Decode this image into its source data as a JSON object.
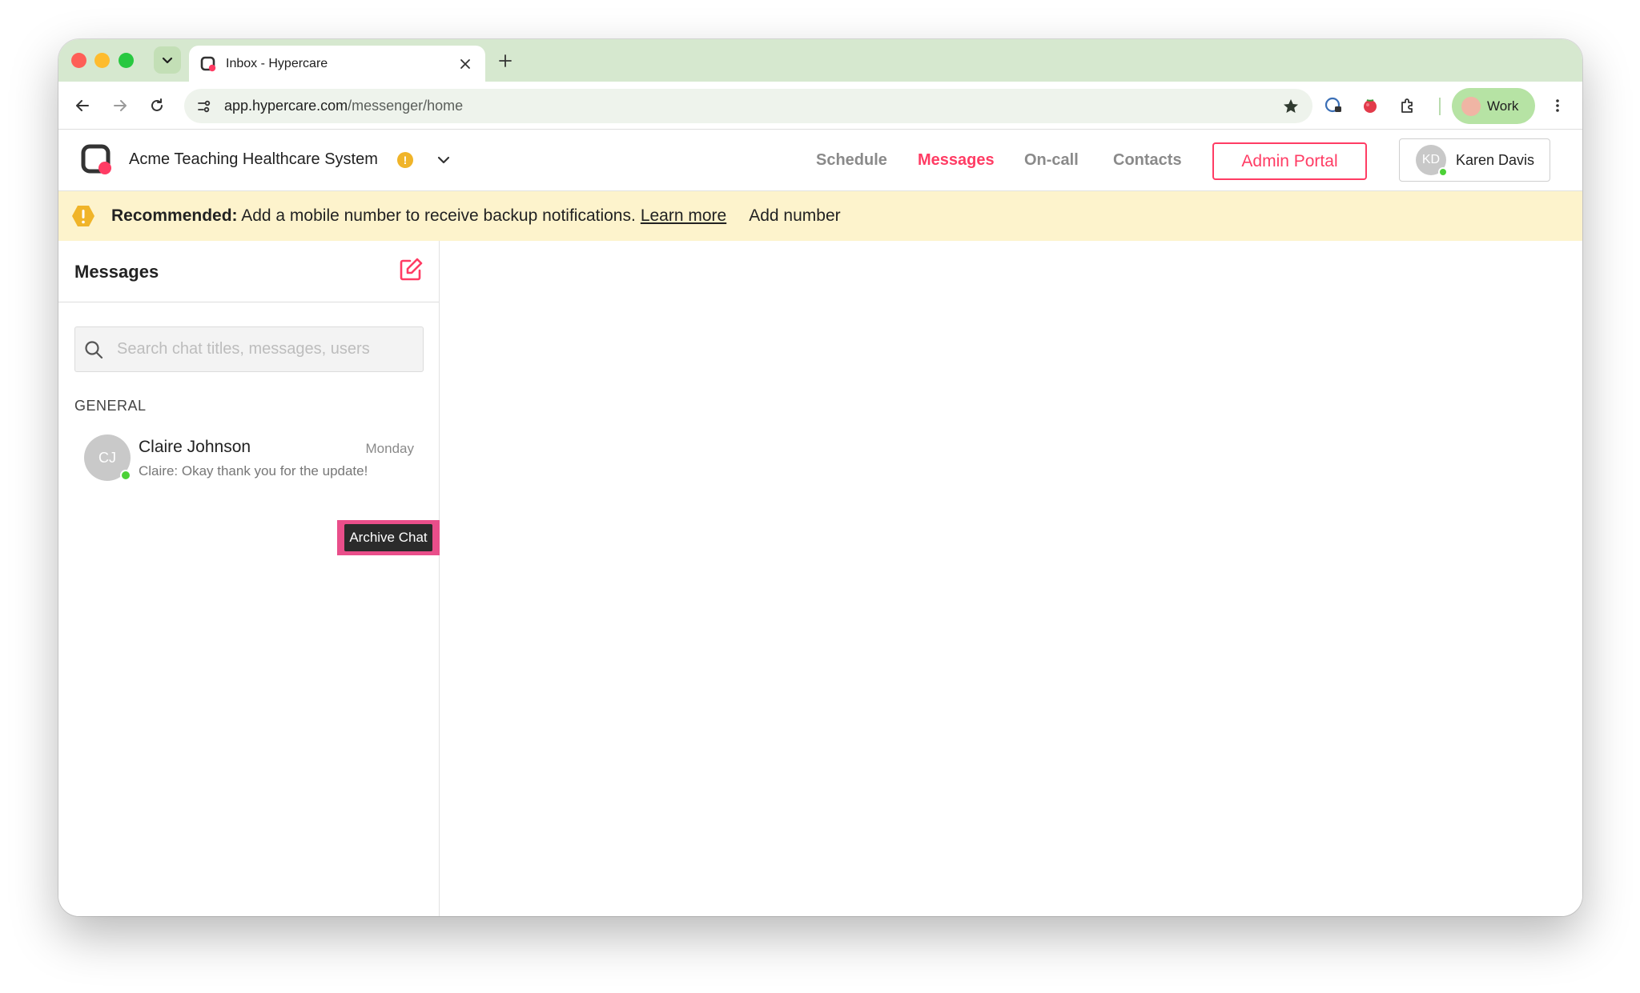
{
  "browser": {
    "tab_title": "Inbox - Hypercare",
    "url_host": "app.hypercare.com",
    "url_path": "/messenger/home",
    "profile_label": "Work"
  },
  "header": {
    "org_name": "Acme Teaching Healthcare System",
    "nav": [
      {
        "label": "Schedule",
        "active": false
      },
      {
        "label": "Messages",
        "active": true
      },
      {
        "label": "On-call",
        "active": false
      },
      {
        "label": "Contacts",
        "active": false
      }
    ],
    "admin_button": "Admin Portal",
    "user": {
      "initials": "KD",
      "name": "Karen Davis"
    }
  },
  "banner": {
    "bold": "Recommended:",
    "text": " Add a mobile number to receive backup notifications.",
    "link": "Learn more",
    "action": "Add number"
  },
  "sidebar": {
    "title": "Messages",
    "search_placeholder": "Search chat titles, messages, users",
    "section": "GENERAL",
    "chats": [
      {
        "initials": "CJ",
        "name": "Claire Johnson",
        "time": "Monday",
        "preview": "Claire: Okay thank you for the update!"
      }
    ],
    "tooltip": "Archive Chat"
  },
  "colors": {
    "accent": "#ff3c64",
    "tab_strip": "#d6e8cf",
    "banner": "#fdf3cc",
    "presence": "#4cd137",
    "highlight": "#e94e8a"
  }
}
